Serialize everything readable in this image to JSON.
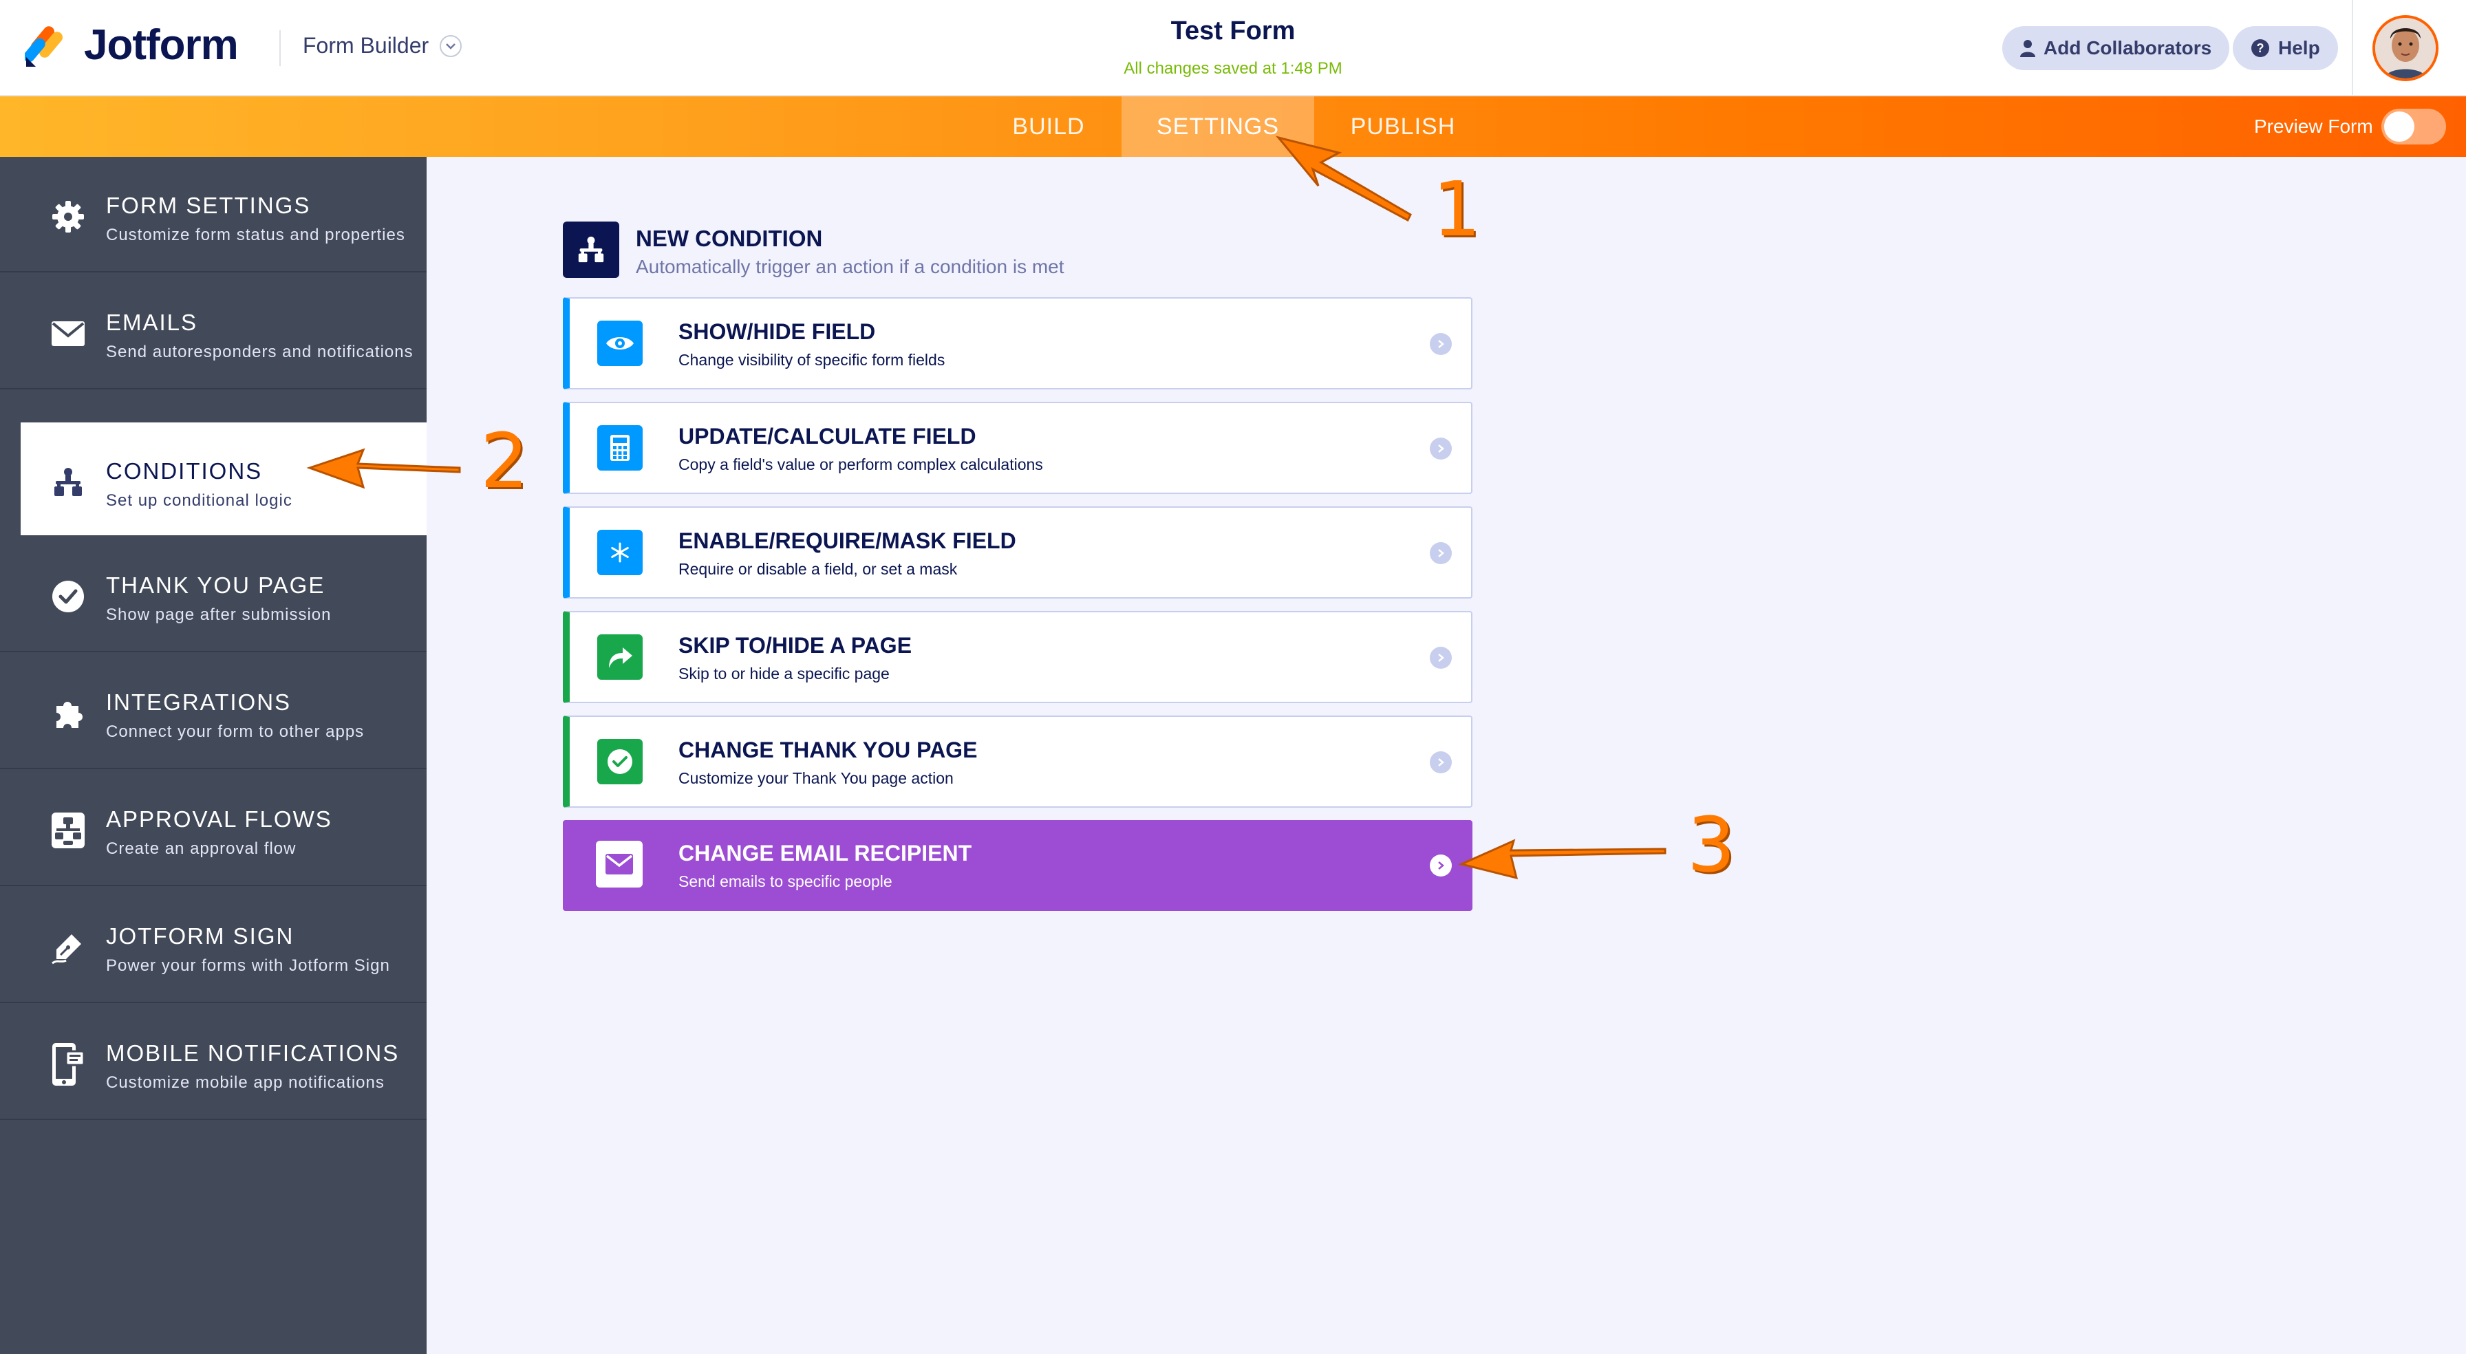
{
  "header": {
    "brand": "Jotform",
    "builder_label": "Form Builder",
    "form_title": "Test Form",
    "saved_status": "All changes saved at 1:48 PM",
    "add_collaborators": "Add Collaborators",
    "help": "Help"
  },
  "nav": {
    "tabs": [
      {
        "label": "BUILD"
      },
      {
        "label": "SETTINGS",
        "active": true
      },
      {
        "label": "PUBLISH"
      }
    ],
    "preview_label": "Preview Form"
  },
  "sidebar": {
    "items": [
      {
        "title": "FORM SETTINGS",
        "subtitle": "Customize form status and properties",
        "icon": "gear-icon"
      },
      {
        "title": "EMAILS",
        "subtitle": "Send autoresponders and notifications",
        "icon": "envelope-icon"
      },
      {
        "title": "CONDITIONS",
        "subtitle": "Set up conditional logic",
        "icon": "sitemap-icon",
        "active": true
      },
      {
        "title": "THANK YOU PAGE",
        "subtitle": "Show page after submission",
        "icon": "check-circle-icon"
      },
      {
        "title": "INTEGRATIONS",
        "subtitle": "Connect your form to other apps",
        "icon": "puzzle-icon"
      },
      {
        "title": "APPROVAL FLOWS",
        "subtitle": "Create an approval flow",
        "icon": "flow-icon"
      },
      {
        "title": "JOTFORM SIGN",
        "subtitle": "Power your forms with Jotform Sign",
        "icon": "pen-icon"
      },
      {
        "title": "MOBILE NOTIFICATIONS",
        "subtitle": "Customize mobile app notifications",
        "icon": "mobile-icon"
      }
    ]
  },
  "main": {
    "new_condition": {
      "title": "NEW CONDITION",
      "subtitle": "Automatically trigger an action if a condition is met"
    },
    "conditions": [
      {
        "title": "SHOW/HIDE FIELD",
        "subtitle": "Change visibility of specific form fields",
        "icon": "eye-icon",
        "color": "#0099ff"
      },
      {
        "title": "UPDATE/CALCULATE FIELD",
        "subtitle": "Copy a field's value or perform complex calculations",
        "icon": "calculator-icon",
        "color": "#0099ff"
      },
      {
        "title": "ENABLE/REQUIRE/MASK FIELD",
        "subtitle": "Require or disable a field, or set a mask",
        "icon": "asterisk-icon",
        "color": "#0099ff"
      },
      {
        "title": "SKIP TO/HIDE A PAGE",
        "subtitle": "Skip to or hide a specific page",
        "icon": "share-arrow-icon",
        "color": "#18a84b"
      },
      {
        "title": "CHANGE THANK YOU PAGE",
        "subtitle": "Customize your Thank You page action",
        "icon": "check-icon",
        "color": "#18a84b"
      },
      {
        "title": "CHANGE EMAIL RECIPIENT",
        "subtitle": "Send emails to specific people",
        "icon": "envelope-icon",
        "color": "#9c4dd3"
      }
    ]
  },
  "annotations": [
    "1",
    "2",
    "3"
  ],
  "colors": {
    "accent_orange": "#ff6100",
    "sidebar_bg": "#424958",
    "navy": "#0a1551",
    "purple": "#9c4dd3"
  }
}
